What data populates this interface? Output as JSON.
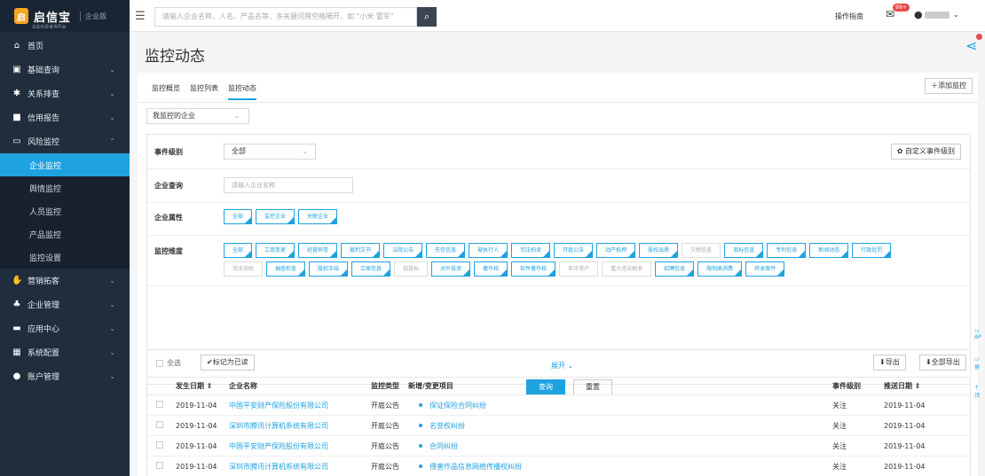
{
  "brand": {
    "name": "启信宝",
    "sub": "企业信息查询平台",
    "edition": "企业版"
  },
  "sidebar": {
    "items": [
      {
        "label": "首页",
        "icon": "home-icon"
      },
      {
        "label": "基础查询",
        "icon": "id-card-icon"
      },
      {
        "label": "关系排查",
        "icon": "network-icon"
      },
      {
        "label": "信用报告",
        "icon": "report-icon"
      },
      {
        "label": "风险监控",
        "icon": "monitor-icon"
      }
    ],
    "sub_items": [
      {
        "label": "企业监控",
        "active": true
      },
      {
        "label": "舆情监控"
      },
      {
        "label": "人员监控"
      },
      {
        "label": "产品监控"
      },
      {
        "label": "监控设置"
      }
    ],
    "items2": [
      {
        "label": "营销拓客",
        "icon": "handshake-icon"
      },
      {
        "label": "企业管理",
        "icon": "org-icon"
      },
      {
        "label": "应用中心",
        "icon": "app-icon"
      },
      {
        "label": "系统配置",
        "icon": "grid-icon"
      },
      {
        "label": "账户管理",
        "icon": "user-icon"
      }
    ]
  },
  "topbar": {
    "search_placeholder": "请输入企业名称、人名、产品名等，多关键词用空格隔开，如 \"小米 雷军\"",
    "guide": "操作指南",
    "badge": "99+"
  },
  "page": {
    "title": "监控动态"
  },
  "tabs": [
    "监控概览",
    "监控列表",
    "监控动态"
  ],
  "add_monitor": "添加监控",
  "my_select": "我监控的企业",
  "filter": {
    "event_level_label": "事件级别",
    "event_level_value": "全部",
    "custom_level": "自定义事件级别",
    "company_query_label": "企业查询",
    "company_query_placeholder": "请输入企业名称",
    "attr_label": "企业属性",
    "attr_tags": [
      "全部",
      "监控企业",
      "关联企业"
    ],
    "dim_label": "监控维度",
    "dim_tags": [
      {
        "t": "全部",
        "s": "sel"
      },
      {
        "t": "工商变更",
        "s": "sel"
      },
      {
        "t": "经营异常",
        "s": "sel"
      },
      {
        "t": "裁判文书",
        "s": "sel"
      },
      {
        "t": "法院公告",
        "s": "sel"
      },
      {
        "t": "失信信息",
        "s": "sel"
      },
      {
        "t": "被执行人",
        "s": "sel"
      },
      {
        "t": "司法拍卖",
        "s": "sel"
      },
      {
        "t": "开庭公告",
        "s": "sel"
      },
      {
        "t": "动产抵押",
        "s": "sel"
      },
      {
        "t": "股权出质",
        "s": "sel"
      },
      {
        "t": "欠税信息",
        "s": "off"
      },
      {
        "t": "商标信息",
        "s": "sel"
      },
      {
        "t": "专利信息",
        "s": "sel"
      },
      {
        "t": "新闻动态",
        "s": "sel"
      },
      {
        "t": "行政处罚",
        "s": "sel"
      },
      {
        "t": "司法协助",
        "s": "off"
      },
      {
        "t": "抽查检查",
        "s": "sel"
      },
      {
        "t": "股权冻结",
        "s": "sel"
      },
      {
        "t": "立案信息",
        "s": "sel"
      },
      {
        "t": "招投标",
        "s": "off"
      },
      {
        "t": "对外投资",
        "s": "sel"
      },
      {
        "t": "著作权",
        "s": "sel"
      },
      {
        "t": "软件著作权",
        "s": "sel"
      },
      {
        "t": "非正常户",
        "s": "off"
      },
      {
        "t": "重大违法税收",
        "s": "off"
      },
      {
        "t": "招聘信息",
        "s": "sel"
      },
      {
        "t": "限制高消费",
        "s": "sel"
      },
      {
        "t": "终本案件",
        "s": "sel"
      }
    ],
    "expand": "展开",
    "query": "查询",
    "reset": "重置"
  },
  "table": {
    "select_all": "全选",
    "mark_read": "标记为已读",
    "export": "导出",
    "export_all": "全部导出",
    "headers": [
      "发生日期",
      "企业名称",
      "监控类型",
      "新增/变更项目",
      "事件级别",
      "推送日期"
    ],
    "rows": [
      {
        "date": "2019-11-04",
        "company": "中国平安财产保险股份有限公司",
        "type": "开庭公告",
        "item": "保证保险合同纠纷",
        "level": "关注",
        "push": "2019-11-04"
      },
      {
        "date": "2019-11-04",
        "company": "深圳市腾讯计算机系统有限公司",
        "type": "开庭公告",
        "item": "名誉权纠纷",
        "level": "关注",
        "push": "2019-11-04"
      },
      {
        "date": "2019-11-04",
        "company": "中国平安财产保险股份有限公司",
        "type": "开庭公告",
        "item": "合同纠纷",
        "level": "关注",
        "push": "2019-11-04"
      },
      {
        "date": "2019-11-04",
        "company": "深圳市腾讯计算机系统有限公司",
        "type": "开庭公告",
        "item": "侵害作品信息网络传播权纠纷",
        "level": "关注",
        "push": "2019-11-04"
      }
    ]
  },
  "float_bar": {
    "api": "AP",
    "feedback": "留",
    "top": "顶"
  },
  "colors": {
    "accent": "#1fa2e0",
    "sidebar": "#1f2d3d"
  }
}
